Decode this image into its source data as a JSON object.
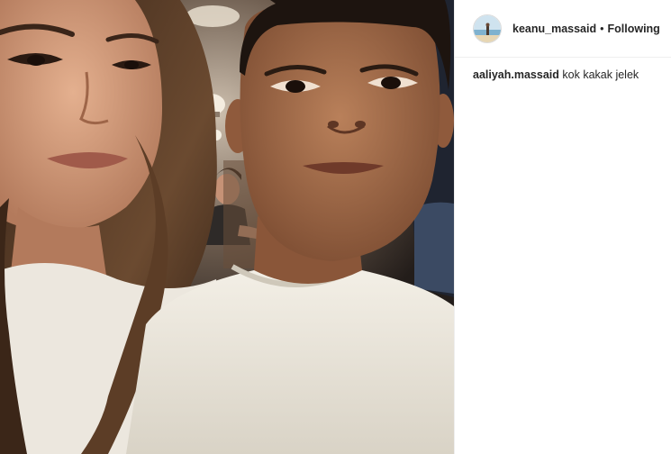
{
  "post": {
    "author": {
      "username": "keanu_massaid",
      "separator": "•",
      "follow_status": "Following",
      "avatar_icon": "profile-avatar-beach"
    },
    "comments": [
      {
        "username": "aaliyah.massaid",
        "text": "kok kakak jelek"
      }
    ],
    "photo_icon": "selfie-photo"
  }
}
